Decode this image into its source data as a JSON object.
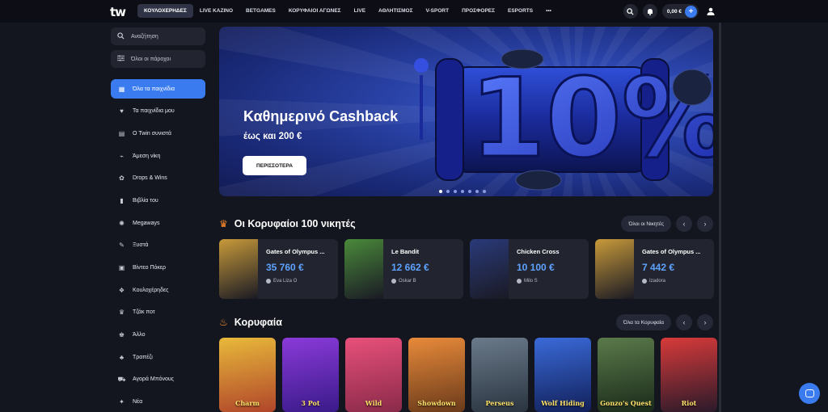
{
  "brand": {
    "logo_text": "tw"
  },
  "nav": {
    "items": [
      "ΚΟΥΛΟΧΕΡΗΔΕΣ",
      "LIVE ΚΑΖΙΝΟ",
      "BETGAMES",
      "ΚΟΡΥΦΑΙΟΙ ΑΓΩΝΕΣ",
      "LIVE",
      "ΑΘΛΗΤΙΣΜΟΣ",
      "V-SPORT",
      "ΠΡΟΣΦΟΡΕΣ",
      "ESPORTS",
      "•••"
    ],
    "active_index": 0
  },
  "account": {
    "balance": "0,00 €",
    "plus": "+"
  },
  "sidebar": {
    "search": "Αναζήτηση",
    "providers": "Όλοι οι πάροχοι",
    "items": [
      {
        "label": "Όλα τα παιχνίδια",
        "icon": "grid-icon",
        "glyph": "▦"
      },
      {
        "label": "Τα παιχνίδια μου",
        "icon": "heart-icon",
        "glyph": "♥"
      },
      {
        "label": "Ο Twin συνιστά",
        "icon": "slot-icon",
        "glyph": "▤"
      },
      {
        "label": "Άμεση νίκη",
        "icon": "chart-icon",
        "glyph": "⌁"
      },
      {
        "label": "Drops & Wins",
        "icon": "drops-icon",
        "glyph": "✿"
      },
      {
        "label": "Βιβλία του",
        "icon": "book-icon",
        "glyph": "▮"
      },
      {
        "label": "Megaways",
        "icon": "megaways-icon",
        "glyph": "✺"
      },
      {
        "label": "Ξυστά",
        "icon": "scratch-icon",
        "glyph": "✎"
      },
      {
        "label": "Βίντεο Πόκερ",
        "icon": "poker-icon",
        "glyph": "▣"
      },
      {
        "label": "Κουλοχέρηδες",
        "icon": "slots-icon",
        "glyph": "❖"
      },
      {
        "label": "Τζάκ ποτ",
        "icon": "jackpot-icon",
        "glyph": "♛"
      },
      {
        "label": "Άλλο",
        "icon": "crown-icon",
        "glyph": "♚"
      },
      {
        "label": "Τραπέζι",
        "icon": "table-icon",
        "glyph": "♣"
      },
      {
        "label": "Αγορά Μπόνους",
        "icon": "cart-icon",
        "glyph": "⛟"
      },
      {
        "label": "Νέα",
        "icon": "new-icon",
        "glyph": "✦"
      }
    ]
  },
  "banner": {
    "title": "Καθημερινό Cashback",
    "subtitle": "έως και 200 €",
    "button": "ΠΕΡΙΣΣΟΤΕΡΑ",
    "art_text": "10%",
    "slides": 7,
    "active_slide": 0
  },
  "winners": {
    "title": "Οι Κορυφαίοι 100 νικητές",
    "all_label": "Όλοι οι Νικητές",
    "items": [
      {
        "game": "Gates of Olympus ...",
        "amount": "35 760 €",
        "user": "Eva Liza O",
        "color": "#c89a3a"
      },
      {
        "game": "Le Bandit",
        "amount": "12 662 €",
        "user": "Oskar B",
        "color": "#4a8a3a"
      },
      {
        "game": "Chicken Cross",
        "amount": "10 100 €",
        "user": "Milo S",
        "color": "#2a3a7a"
      },
      {
        "game": "Gates of Olympus ...",
        "amount": "7 442 €",
        "user": "Izadora",
        "color": "#c89a3a"
      }
    ]
  },
  "top": {
    "title": "Κορυφαία",
    "all_label": "Όλα τα Κορυφαία",
    "games": [
      {
        "name": "Charm",
        "c1": "#e8b93a",
        "c2": "#b0452a"
      },
      {
        "name": "3 Pot",
        "c1": "#8a3ad8",
        "c2": "#3a1a8a"
      },
      {
        "name": "Wild",
        "c1": "#e8507a",
        "c2": "#8a2a4a"
      },
      {
        "name": "Showdown",
        "c1": "#e88a3a",
        "c2": "#6a3a1a"
      },
      {
        "name": "Perseus",
        "c1": "#6a7a8a",
        "c2": "#2a3440"
      },
      {
        "name": "Wolf Hiding",
        "c1": "#3a6ad8",
        "c2": "#12205a"
      },
      {
        "name": "Gonzo's Quest",
        "c1": "#5a7a4a",
        "c2": "#1a2a1a"
      },
      {
        "name": "Riot",
        "c1": "#d83a3a",
        "c2": "#2a1a2a"
      }
    ]
  }
}
